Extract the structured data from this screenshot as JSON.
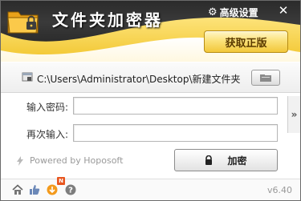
{
  "app": {
    "title": "文件夹加密器",
    "settings_label": "高级设置",
    "close_glyph": "✕",
    "get_pro_label": "获取正版"
  },
  "path_bar": {
    "path": "C:\\Users\\Administrator\\Desktop\\新建文件夹"
  },
  "form": {
    "password_label": "输入密码:",
    "confirm_label": "再次输入:",
    "password_value": "",
    "confirm_value": "",
    "side_toggle_glyph": "»"
  },
  "powered_by": "Powered by Hoposoft",
  "encrypt_label": "加密",
  "footer": {
    "badge": "N",
    "version": "v6.40",
    "icons": [
      "home-icon",
      "thumbs-up-icon",
      "update-icon",
      "help-icon"
    ]
  },
  "colors": {
    "header_dark": "#2b2b2b",
    "header_yellow": "#f5cd3a",
    "pro_button": "#fbe27b",
    "badge": "#e8561f"
  }
}
